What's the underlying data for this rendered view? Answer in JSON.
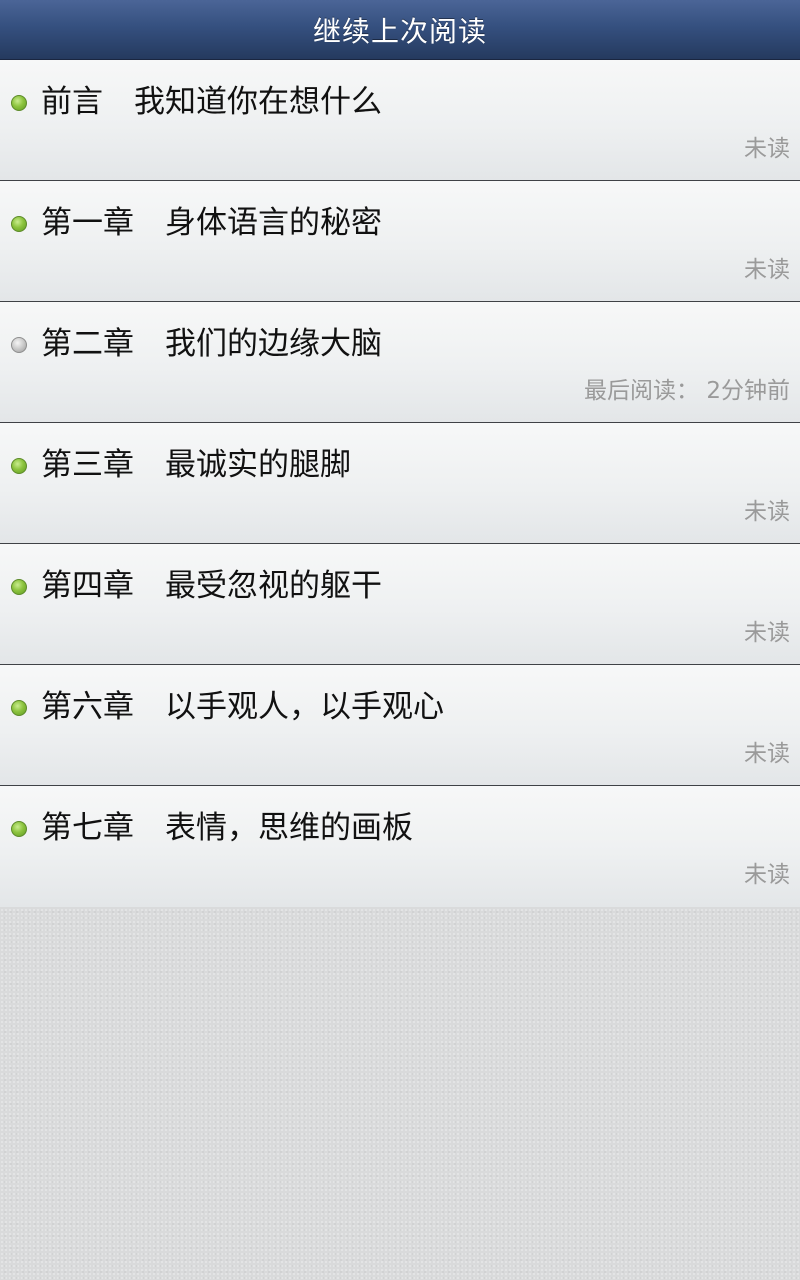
{
  "header": {
    "title": "继续上次阅读"
  },
  "chapters": [
    {
      "title": "前言　我知道你在想什么",
      "status": "未读",
      "state": "unread"
    },
    {
      "title": "第一章　身体语言的秘密",
      "status": "未读",
      "state": "unread"
    },
    {
      "title": "第二章　我们的边缘大脑",
      "status": "最后阅读： 2分钟前",
      "state": "read"
    },
    {
      "title": "第三章　最诚实的腿脚",
      "status": "未读",
      "state": "unread"
    },
    {
      "title": "第四章　最受忽视的躯干",
      "status": "未读",
      "state": "unread"
    },
    {
      "title": "第六章　以手观人，以手观心",
      "status": "未读",
      "state": "unread"
    },
    {
      "title": "第七章　表情，思维的画板",
      "status": "未读",
      "state": "unread"
    }
  ],
  "colors": {
    "header_top": "#4b6597",
    "header_bottom": "#253a5f",
    "unread_dot": "#8dc43f",
    "read_dot": "#c9c9c9",
    "status_text": "#9a9a9a"
  },
  "icons": {
    "unread": "green-dot-icon",
    "read": "gray-dot-icon"
  }
}
